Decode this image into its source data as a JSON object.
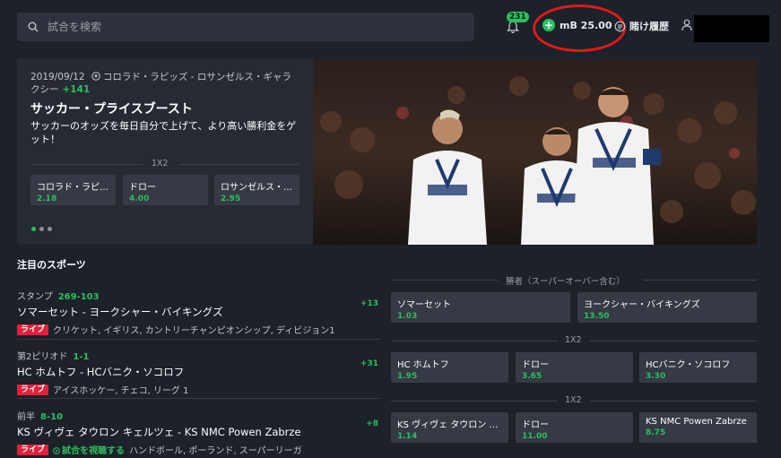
{
  "header": {
    "search_placeholder": "試合を検索",
    "notification_count": "231",
    "balance": "mB 25.00",
    "history_label": "賭け履歴"
  },
  "promo": {
    "date": "2019/09/12",
    "match": "コロラド・ラピッズ - ロサンゼルス・ギャラクシー",
    "more": "+141",
    "title": "サッカー・プライスブースト",
    "description": "サッカーのオッズを毎日自分で上げて、より高い勝利金をゲット！",
    "market": "1X2",
    "odds": [
      {
        "name": "コロラド・ラピ…",
        "value": "2.18"
      },
      {
        "name": "ドロー",
        "value": "4.00"
      },
      {
        "name": "ロサンゼルス・…",
        "value": "2.95"
      }
    ]
  },
  "featured": {
    "title": "注目のスポーツ",
    "events": [
      {
        "stage": "スタンプ",
        "score": "269-103",
        "teams": "ソマーセット - ヨークシャー・バイキングズ",
        "live": "ライブ",
        "watch": "",
        "info": "クリケット, イギリス, カントリーチャンピオンシップ, ディビジョン1",
        "more": "+13",
        "market": "勝者（スーパーオーバー含む）",
        "odds": [
          {
            "name": "ソマーセット",
            "value": "1.03"
          },
          {
            "name": "ヨークシャー・バイキングズ",
            "value": "13.50"
          }
        ]
      },
      {
        "stage": "第2ピリオド",
        "score": "1-1",
        "teams": "HC ホムトフ - HCバニク・ソコロフ",
        "live": "ライブ",
        "watch": "",
        "info": "アイスホッケー, チェコ, リーグ 1",
        "more": "+31",
        "market": "1X2",
        "odds": [
          {
            "name": "HC ホムトフ",
            "value": "1.95"
          },
          {
            "name": "ドロー",
            "value": "3.65"
          },
          {
            "name": "HCバニク・ソコロフ",
            "value": "3.30"
          }
        ]
      },
      {
        "stage": "前半",
        "score": "8-10",
        "teams": "KS ヴィヴェ タウロン キェルツェ - KS NMC Powen Zabrze",
        "live": "ライブ",
        "watch": "試合を視聴する",
        "info": "ハンドボール, ポーランド, スーパーリーガ",
        "more": "+8",
        "market": "1X2",
        "odds": [
          {
            "name": "KS ヴィヴェ タウロン …",
            "value": "1.14"
          },
          {
            "name": "ドロー",
            "value": "11.00"
          },
          {
            "name": "KS NMC Powen Zabrze",
            "value": "8.75"
          }
        ]
      }
    ]
  }
}
